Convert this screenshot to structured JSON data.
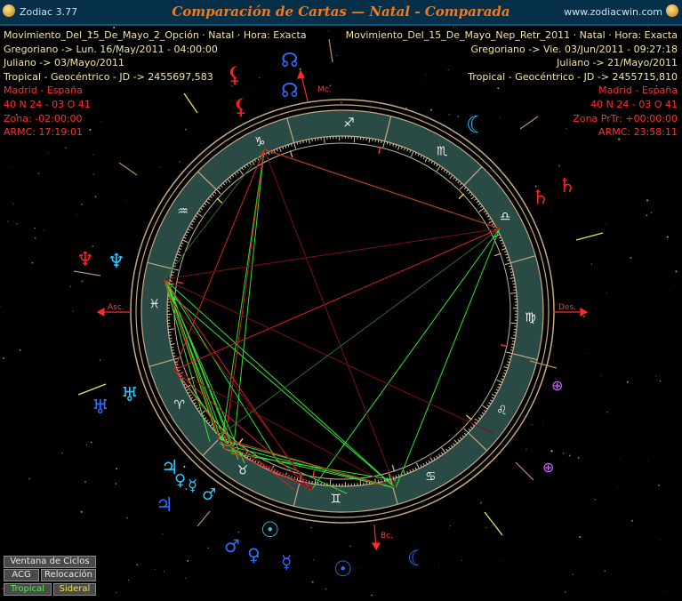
{
  "window": {
    "app_title": "Zodiac 3.77",
    "chart_title": "Comparación de Cartas — Natal - Comparada",
    "website": "www.zodiacwin.com"
  },
  "natal": {
    "name": "Movimiento_Del_15_De_Mayo_2_Opción · Natal · Hora: Exacta",
    "gregorian": "Gregoriano -> Lun. 16/May/2011 - 04:00:00",
    "julian": "Juliano -> 03/Mayo/2011",
    "jd": "Tropical - Geocéntrico - JD -> 2455697,583",
    "place": "Madrid - España",
    "coords": "40 N 24 - 03 O 41",
    "zone": "Zona: -02:00:00",
    "armc": "ARMC: 17:19:01"
  },
  "compared": {
    "name": "Movimiento_Del_15_De_Mayo_Nep_Retr_2011 · Natal · Hora: Exacta",
    "gregorian": "Gregoriano -> Vie. 03/Jun/2011 - 09:27:18",
    "julian": "Juliano -> 21/Mayo/2011",
    "jd": "Tropical - Geocéntrico - JD -> 2455715,810",
    "place": "Madrid - España",
    "coords": "40 N 24 - 03 O 41",
    "zone": "Zona PrTr: +00:00:00",
    "armc": "ARMC: 23:58:11"
  },
  "angles": {
    "asc": "Asc.",
    "des": "Des.",
    "mc": "Mc.",
    "bc": "Bc."
  },
  "zodiac_signs": [
    "♈",
    "♉",
    "♊",
    "♋",
    "♌",
    "♍",
    "♎",
    "♏",
    "♐",
    "♑",
    "♒",
    "♓"
  ],
  "planets": {
    "sun": "☉",
    "moon": "☾",
    "mercury": "☿",
    "venus": "♀",
    "mars": "♂",
    "jupiter": "♃",
    "saturn": "♄",
    "uranus": "♅",
    "neptune": "♆",
    "pluto": "♇",
    "node": "☊",
    "part_of_fortune": "⊕",
    "lilith": "⚸"
  },
  "buttons": {
    "cycles": "Ventana de Ciclos",
    "acg": "ACG",
    "relocation": "Relocación",
    "tropical": "Tropical",
    "sidereal": "Sideral"
  },
  "colors": {
    "titlebar": "#062f4a",
    "title_text": "#f07a1e",
    "info_text": "#f2e4a8",
    "info_text_alt": "#ff3030",
    "zodiac_ring": "#2a4a46",
    "wheel_border": "#c4a882",
    "aspect_green": "#2ee52e",
    "aspect_red": "#d92020",
    "planet_blue": "#2d6cff",
    "planet_cyan": "#26c8ff",
    "planet_red": "#ff2020",
    "planet_purple": "#cc66ff"
  }
}
